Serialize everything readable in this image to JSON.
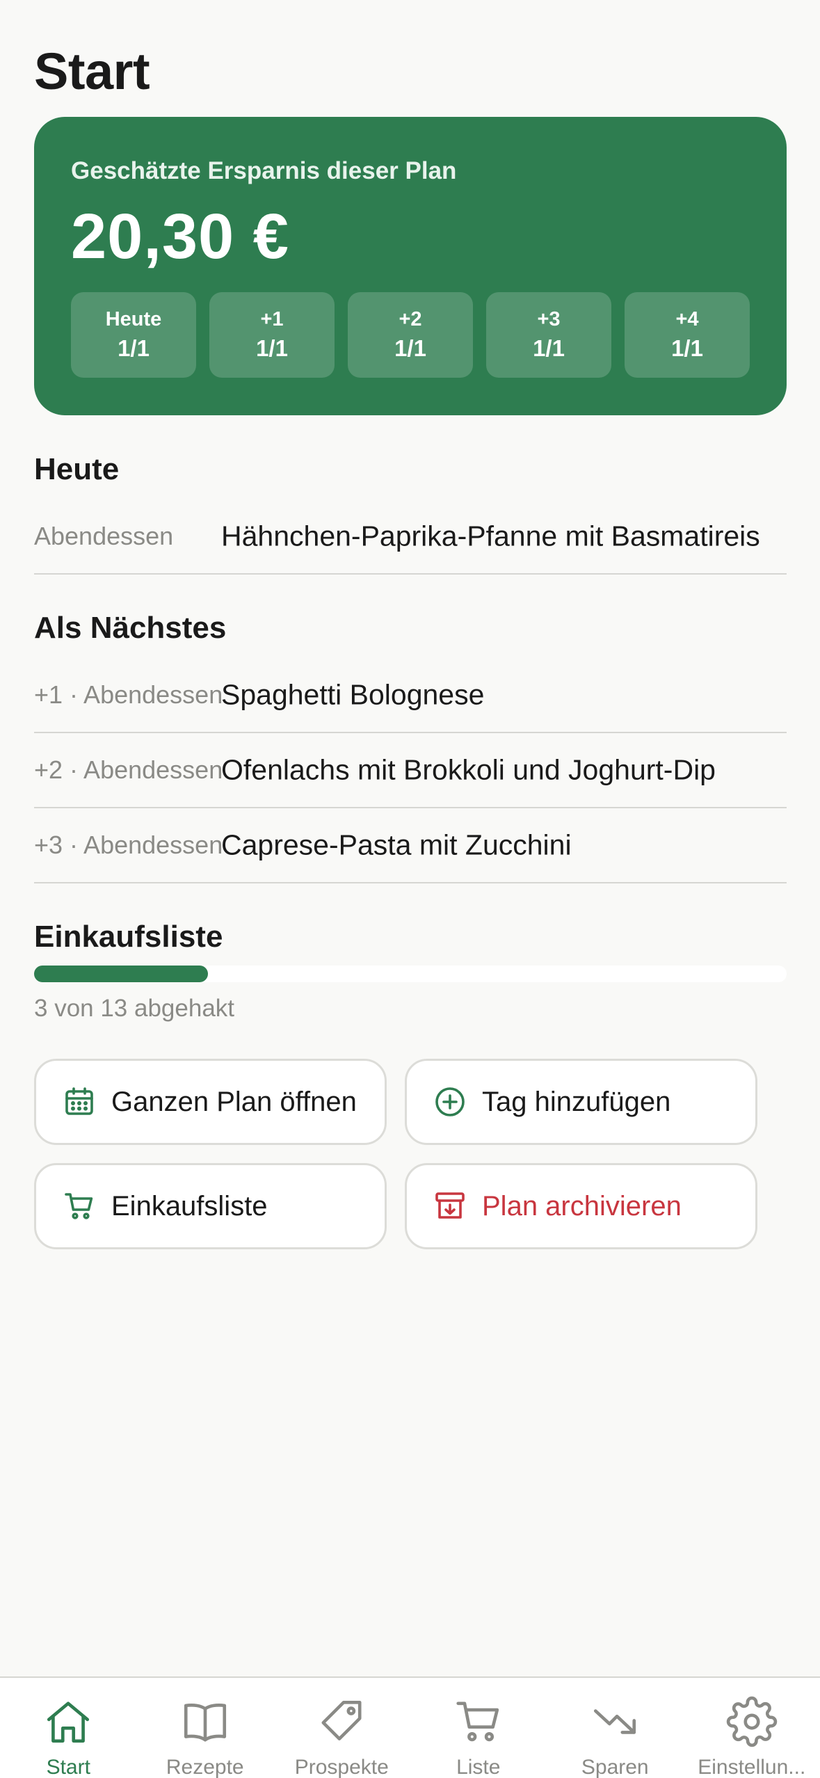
{
  "page": {
    "title": "Start"
  },
  "savings": {
    "label": "Geschätzte Ersparnis dieser Plan",
    "amount": "20,30 €",
    "days": [
      {
        "day": "Heute",
        "count": "1/1"
      },
      {
        "day": "+1",
        "count": "1/1"
      },
      {
        "day": "+2",
        "count": "1/1"
      },
      {
        "day": "+3",
        "count": "1/1"
      },
      {
        "day": "+4",
        "count": "1/1"
      }
    ]
  },
  "today": {
    "title": "Heute",
    "meals": [
      {
        "meta": "Abendessen",
        "name": "Hähnchen-Paprika-Pfanne mit Basmatireis"
      }
    ]
  },
  "next": {
    "title": "Als Nächstes",
    "meals": [
      {
        "meta": "+1 · Abendessen",
        "name": "Spaghetti Bolognese"
      },
      {
        "meta": "+2 · Abendessen",
        "name": "Ofenlachs mit Brokkoli und Joghurt-Dip"
      },
      {
        "meta": "+3 · Abendessen",
        "name": "Caprese-Pasta mit Zucchini"
      }
    ]
  },
  "shopping": {
    "title": "Einkaufsliste",
    "checked": 3,
    "total": 13,
    "caption": "3 von 13 abgehakt"
  },
  "actions": {
    "open_plan": {
      "label": "Ganzen Plan öffnen",
      "icon": "calendar-icon"
    },
    "add_day": {
      "label": "Tag hinzufügen",
      "icon": "plus-circle-icon"
    },
    "shopping_list": {
      "label": "Einkaufsliste",
      "icon": "cart-icon"
    },
    "archive_plan": {
      "label": "Plan archivieren",
      "icon": "archive-icon"
    }
  },
  "tabs": [
    {
      "label": "Start",
      "icon": "home-icon",
      "active": true
    },
    {
      "label": "Rezepte",
      "icon": "book-icon",
      "active": false
    },
    {
      "label": "Prospekte",
      "icon": "tag-icon",
      "active": false
    },
    {
      "label": "Liste",
      "icon": "cart-icon",
      "active": false
    },
    {
      "label": "Sparen",
      "icon": "trend-down-icon",
      "active": false
    },
    {
      "label": "Einstellun...",
      "icon": "gear-icon",
      "active": false
    }
  ],
  "colors": {
    "accent": "#2e7d50",
    "danger": "#c8363f",
    "background": "#f9f9f7",
    "muted_text": "#8a8a86"
  }
}
